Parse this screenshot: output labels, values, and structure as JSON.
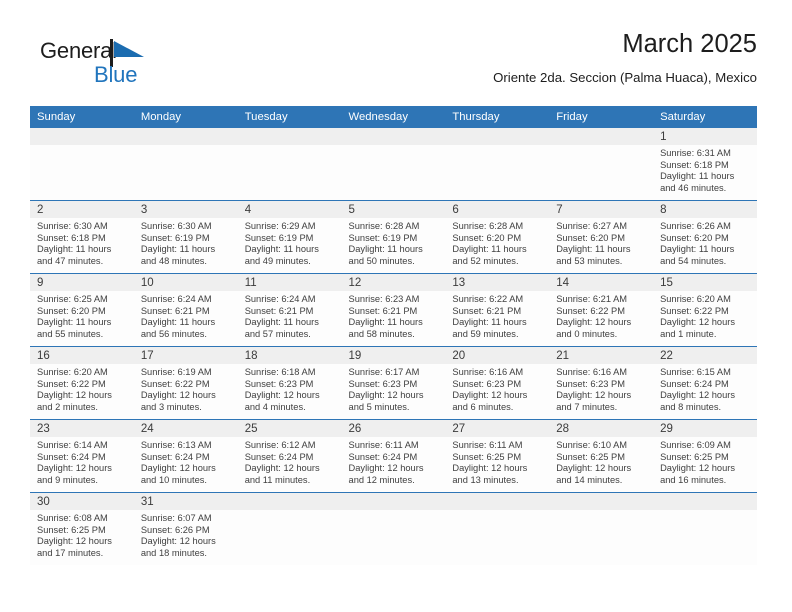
{
  "logo": {
    "word_one": "General",
    "word_two": "Blue",
    "flag_icon": "blue-flag-triangle",
    "brand_blue": "#2175bd"
  },
  "header": {
    "month_title": "March 2025",
    "location": "Oriente 2da. Seccion (Palma Huaca), Mexico"
  },
  "theme": {
    "header_blue": "#2e75b6",
    "daynum_band": "#efefef",
    "cell_bg": "#fdfdfd",
    "text": "#404040"
  },
  "weekdays": [
    "Sunday",
    "Monday",
    "Tuesday",
    "Wednesday",
    "Thursday",
    "Friday",
    "Saturday"
  ],
  "weeks": [
    [
      {
        "day": "",
        "lines": []
      },
      {
        "day": "",
        "lines": []
      },
      {
        "day": "",
        "lines": []
      },
      {
        "day": "",
        "lines": []
      },
      {
        "day": "",
        "lines": []
      },
      {
        "day": "",
        "lines": []
      },
      {
        "day": "1",
        "lines": [
          "Sunrise: 6:31 AM",
          "Sunset: 6:18 PM",
          "Daylight: 11 hours",
          "and 46 minutes."
        ]
      }
    ],
    [
      {
        "day": "2",
        "lines": [
          "Sunrise: 6:30 AM",
          "Sunset: 6:18 PM",
          "Daylight: 11 hours",
          "and 47 minutes."
        ]
      },
      {
        "day": "3",
        "lines": [
          "Sunrise: 6:30 AM",
          "Sunset: 6:19 PM",
          "Daylight: 11 hours",
          "and 48 minutes."
        ]
      },
      {
        "day": "4",
        "lines": [
          "Sunrise: 6:29 AM",
          "Sunset: 6:19 PM",
          "Daylight: 11 hours",
          "and 49 minutes."
        ]
      },
      {
        "day": "5",
        "lines": [
          "Sunrise: 6:28 AM",
          "Sunset: 6:19 PM",
          "Daylight: 11 hours",
          "and 50 minutes."
        ]
      },
      {
        "day": "6",
        "lines": [
          "Sunrise: 6:28 AM",
          "Sunset: 6:20 PM",
          "Daylight: 11 hours",
          "and 52 minutes."
        ]
      },
      {
        "day": "7",
        "lines": [
          "Sunrise: 6:27 AM",
          "Sunset: 6:20 PM",
          "Daylight: 11 hours",
          "and 53 minutes."
        ]
      },
      {
        "day": "8",
        "lines": [
          "Sunrise: 6:26 AM",
          "Sunset: 6:20 PM",
          "Daylight: 11 hours",
          "and 54 minutes."
        ]
      }
    ],
    [
      {
        "day": "9",
        "lines": [
          "Sunrise: 6:25 AM",
          "Sunset: 6:20 PM",
          "Daylight: 11 hours",
          "and 55 minutes."
        ]
      },
      {
        "day": "10",
        "lines": [
          "Sunrise: 6:24 AM",
          "Sunset: 6:21 PM",
          "Daylight: 11 hours",
          "and 56 minutes."
        ]
      },
      {
        "day": "11",
        "lines": [
          "Sunrise: 6:24 AM",
          "Sunset: 6:21 PM",
          "Daylight: 11 hours",
          "and 57 minutes."
        ]
      },
      {
        "day": "12",
        "lines": [
          "Sunrise: 6:23 AM",
          "Sunset: 6:21 PM",
          "Daylight: 11 hours",
          "and 58 minutes."
        ]
      },
      {
        "day": "13",
        "lines": [
          "Sunrise: 6:22 AM",
          "Sunset: 6:21 PM",
          "Daylight: 11 hours",
          "and 59 minutes."
        ]
      },
      {
        "day": "14",
        "lines": [
          "Sunrise: 6:21 AM",
          "Sunset: 6:22 PM",
          "Daylight: 12 hours",
          "and 0 minutes."
        ]
      },
      {
        "day": "15",
        "lines": [
          "Sunrise: 6:20 AM",
          "Sunset: 6:22 PM",
          "Daylight: 12 hours",
          "and 1 minute."
        ]
      }
    ],
    [
      {
        "day": "16",
        "lines": [
          "Sunrise: 6:20 AM",
          "Sunset: 6:22 PM",
          "Daylight: 12 hours",
          "and 2 minutes."
        ]
      },
      {
        "day": "17",
        "lines": [
          "Sunrise: 6:19 AM",
          "Sunset: 6:22 PM",
          "Daylight: 12 hours",
          "and 3 minutes."
        ]
      },
      {
        "day": "18",
        "lines": [
          "Sunrise: 6:18 AM",
          "Sunset: 6:23 PM",
          "Daylight: 12 hours",
          "and 4 minutes."
        ]
      },
      {
        "day": "19",
        "lines": [
          "Sunrise: 6:17 AM",
          "Sunset: 6:23 PM",
          "Daylight: 12 hours",
          "and 5 minutes."
        ]
      },
      {
        "day": "20",
        "lines": [
          "Sunrise: 6:16 AM",
          "Sunset: 6:23 PM",
          "Daylight: 12 hours",
          "and 6 minutes."
        ]
      },
      {
        "day": "21",
        "lines": [
          "Sunrise: 6:16 AM",
          "Sunset: 6:23 PM",
          "Daylight: 12 hours",
          "and 7 minutes."
        ]
      },
      {
        "day": "22",
        "lines": [
          "Sunrise: 6:15 AM",
          "Sunset: 6:24 PM",
          "Daylight: 12 hours",
          "and 8 minutes."
        ]
      }
    ],
    [
      {
        "day": "23",
        "lines": [
          "Sunrise: 6:14 AM",
          "Sunset: 6:24 PM",
          "Daylight: 12 hours",
          "and 9 minutes."
        ]
      },
      {
        "day": "24",
        "lines": [
          "Sunrise: 6:13 AM",
          "Sunset: 6:24 PM",
          "Daylight: 12 hours",
          "and 10 minutes."
        ]
      },
      {
        "day": "25",
        "lines": [
          "Sunrise: 6:12 AM",
          "Sunset: 6:24 PM",
          "Daylight: 12 hours",
          "and 11 minutes."
        ]
      },
      {
        "day": "26",
        "lines": [
          "Sunrise: 6:11 AM",
          "Sunset: 6:24 PM",
          "Daylight: 12 hours",
          "and 12 minutes."
        ]
      },
      {
        "day": "27",
        "lines": [
          "Sunrise: 6:11 AM",
          "Sunset: 6:25 PM",
          "Daylight: 12 hours",
          "and 13 minutes."
        ]
      },
      {
        "day": "28",
        "lines": [
          "Sunrise: 6:10 AM",
          "Sunset: 6:25 PM",
          "Daylight: 12 hours",
          "and 14 minutes."
        ]
      },
      {
        "day": "29",
        "lines": [
          "Sunrise: 6:09 AM",
          "Sunset: 6:25 PM",
          "Daylight: 12 hours",
          "and 16 minutes."
        ]
      }
    ],
    [
      {
        "day": "30",
        "lines": [
          "Sunrise: 6:08 AM",
          "Sunset: 6:25 PM",
          "Daylight: 12 hours",
          "and 17 minutes."
        ]
      },
      {
        "day": "31",
        "lines": [
          "Sunrise: 6:07 AM",
          "Sunset: 6:26 PM",
          "Daylight: 12 hours",
          "and 18 minutes."
        ]
      },
      {
        "day": "",
        "lines": []
      },
      {
        "day": "",
        "lines": []
      },
      {
        "day": "",
        "lines": []
      },
      {
        "day": "",
        "lines": []
      },
      {
        "day": "",
        "lines": []
      }
    ]
  ]
}
